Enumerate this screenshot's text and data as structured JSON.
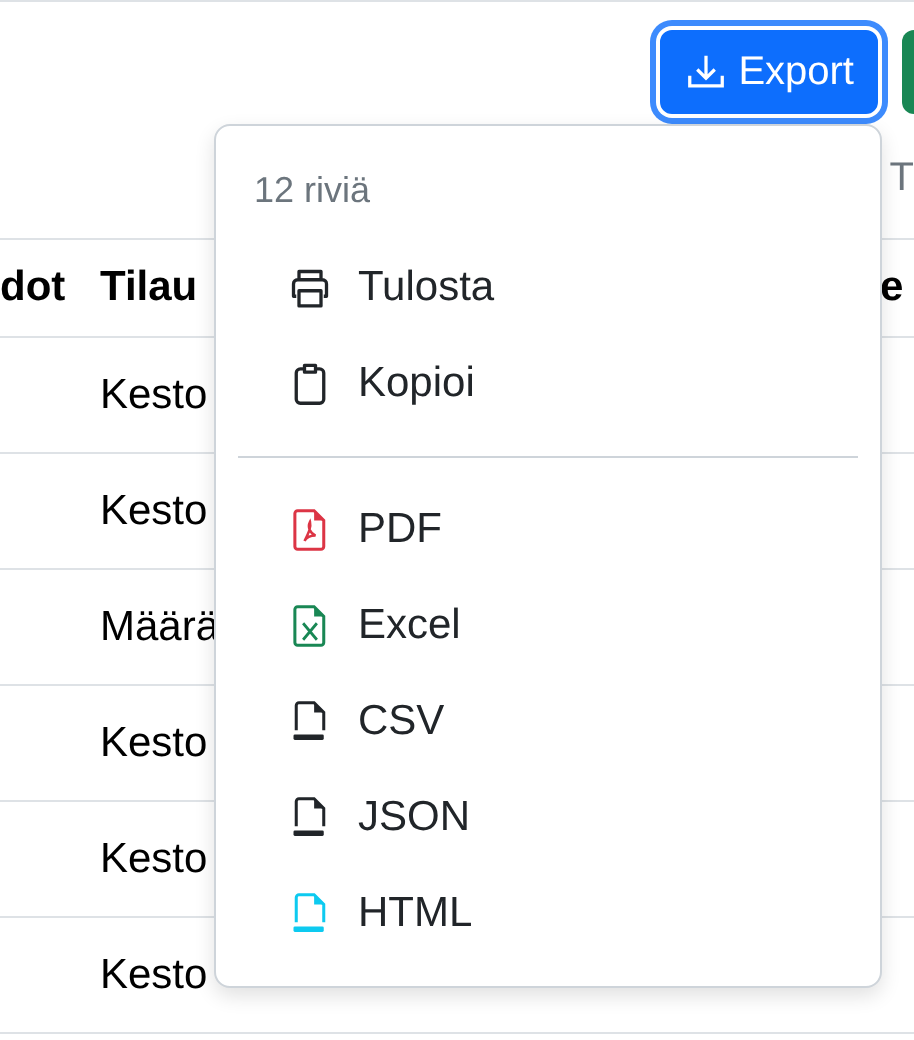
{
  "toolbar": {
    "export_button": "Export",
    "cut_label": "T"
  },
  "table": {
    "columns": [
      "dot",
      "Tilau",
      "e"
    ],
    "rows": [
      {
        "cell": "Kesto"
      },
      {
        "cell": "Kesto"
      },
      {
        "cell": "Määrä"
      },
      {
        "cell": "Kesto"
      },
      {
        "cell": "Kesto"
      },
      {
        "cell": "Kesto"
      }
    ]
  },
  "export_menu": {
    "header": "12 riviä",
    "sections": [
      {
        "items": [
          {
            "kind": "print",
            "label": "Tulosta"
          },
          {
            "kind": "clipboard",
            "label": "Kopioi"
          }
        ]
      },
      {
        "items": [
          {
            "kind": "pdf",
            "label": "PDF"
          },
          {
            "kind": "excel",
            "label": "Excel"
          },
          {
            "kind": "csv",
            "label": "CSV"
          },
          {
            "kind": "json",
            "label": "JSON"
          },
          {
            "kind": "html",
            "label": "HTML"
          }
        ]
      }
    ]
  }
}
